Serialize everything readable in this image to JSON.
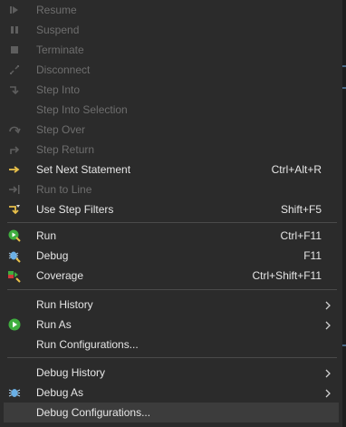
{
  "menu": {
    "items": [
      {
        "key": "resume",
        "label": "Resume",
        "accel": "",
        "icon": "resume-icon",
        "disabled": true,
        "submenu": false
      },
      {
        "key": "suspend",
        "label": "Suspend",
        "accel": "",
        "icon": "suspend-icon",
        "disabled": true,
        "submenu": false
      },
      {
        "key": "terminate",
        "label": "Terminate",
        "accel": "",
        "icon": "terminate-icon",
        "disabled": true,
        "submenu": false
      },
      {
        "key": "disconnect",
        "label": "Disconnect",
        "accel": "",
        "icon": "disconnect-icon",
        "disabled": true,
        "submenu": false
      },
      {
        "key": "step-into",
        "label": "Step Into",
        "accel": "",
        "icon": "step-into-icon",
        "disabled": true,
        "submenu": false
      },
      {
        "key": "step-into-selection",
        "label": "Step Into Selection",
        "accel": "",
        "icon": "",
        "disabled": true,
        "submenu": false
      },
      {
        "key": "step-over",
        "label": "Step Over",
        "accel": "",
        "icon": "step-over-icon",
        "disabled": true,
        "submenu": false
      },
      {
        "key": "step-return",
        "label": "Step Return",
        "accel": "",
        "icon": "step-return-icon",
        "disabled": true,
        "submenu": false
      },
      {
        "key": "set-next-statement",
        "label": "Set Next Statement",
        "accel": "Ctrl+Alt+R",
        "icon": "set-next-statement-icon",
        "disabled": false,
        "submenu": false
      },
      {
        "key": "run-to-line",
        "label": "Run to Line",
        "accel": "",
        "icon": "run-to-line-icon",
        "disabled": true,
        "submenu": false
      },
      {
        "key": "use-step-filters",
        "label": "Use Step Filters",
        "accel": "Shift+F5",
        "icon": "step-filters-icon",
        "disabled": false,
        "submenu": false
      },
      {
        "key": "run",
        "label": "Run",
        "accel": "Ctrl+F11",
        "icon": "run-icon",
        "disabled": false,
        "submenu": false
      },
      {
        "key": "debug",
        "label": "Debug",
        "accel": "F11",
        "icon": "debug-icon",
        "disabled": false,
        "submenu": false
      },
      {
        "key": "coverage",
        "label": "Coverage",
        "accel": "Ctrl+Shift+F11",
        "icon": "coverage-icon",
        "disabled": false,
        "submenu": false
      },
      {
        "key": "run-history",
        "label": "Run History",
        "accel": "",
        "icon": "",
        "disabled": false,
        "submenu": true
      },
      {
        "key": "run-as",
        "label": "Run As",
        "accel": "",
        "icon": "run-as-icon",
        "disabled": false,
        "submenu": true
      },
      {
        "key": "run-configurations",
        "label": "Run Configurations...",
        "accel": "",
        "icon": "",
        "disabled": false,
        "submenu": false
      },
      {
        "key": "debug-history",
        "label": "Debug History",
        "accel": "",
        "icon": "",
        "disabled": false,
        "submenu": true
      },
      {
        "key": "debug-as",
        "label": "Debug As",
        "accel": "",
        "icon": "debug-as-icon",
        "disabled": false,
        "submenu": true
      },
      {
        "key": "debug-configurations",
        "label": "Debug Configurations...",
        "accel": "",
        "icon": "",
        "disabled": false,
        "submenu": false,
        "highlighted": true
      }
    ]
  },
  "colors": {
    "background": "#2b2b2b",
    "text": "#e6e6e6",
    "disabled_text": "#6e6e6e",
    "separator": "#4a4a4a",
    "highlight": "#3c3c3c"
  }
}
